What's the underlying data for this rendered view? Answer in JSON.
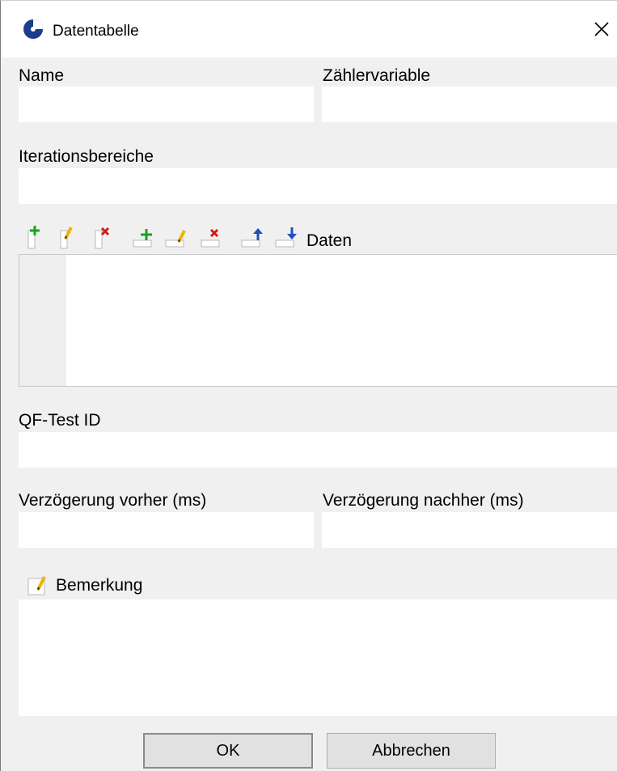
{
  "window": {
    "title": "Datentabelle"
  },
  "fields": {
    "name_label": "Name",
    "counter_label": "Zählervariable",
    "iteration_label": "Iterationsbereiche",
    "data_label": "Daten",
    "id_label": "QF-Test ID",
    "delay_before_label": "Verzögerung vorher (ms)",
    "delay_after_label": "Verzögerung nachher (ms)",
    "comment_label": "Bemerkung"
  },
  "toolbar": {
    "icons": [
      "add-column-icon",
      "edit-column-icon",
      "delete-column-icon",
      "add-row-icon",
      "edit-row-icon",
      "delete-row-icon",
      "move-up-icon",
      "move-down-icon"
    ]
  },
  "buttons": {
    "ok": "OK",
    "cancel": "Abbrechen"
  },
  "colors": {
    "add": "#1aa31a",
    "edit": "#f0b400",
    "delete": "#d11a1a",
    "move": "#1f4fbf"
  }
}
